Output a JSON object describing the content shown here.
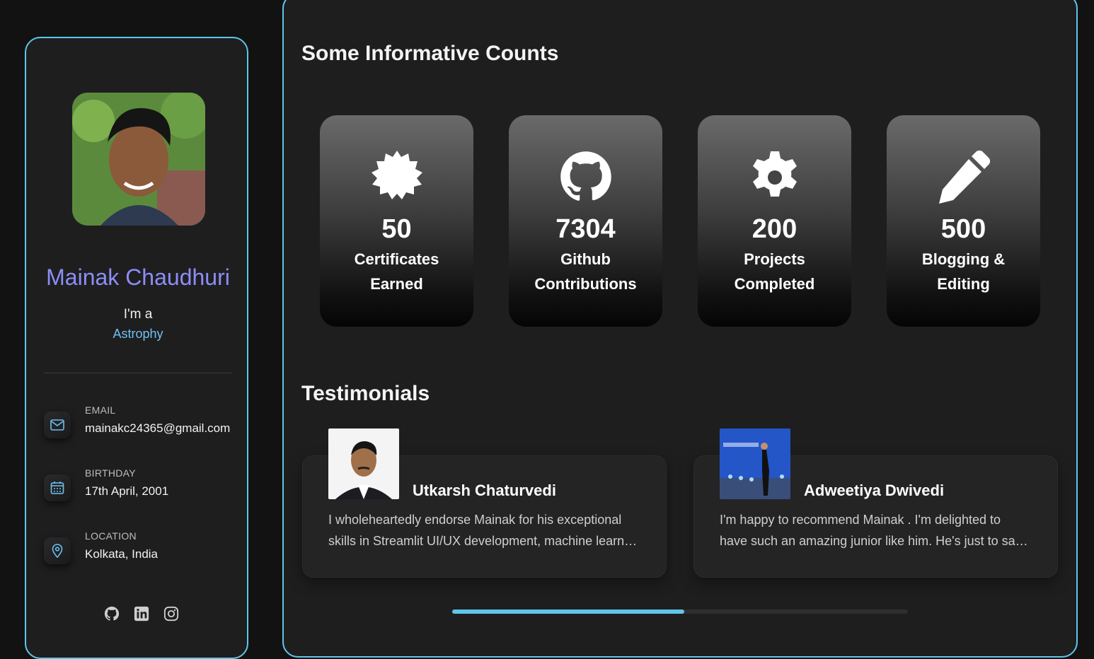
{
  "profile": {
    "name": "Mainak Chaudhuri",
    "im_a": "I'm a",
    "role": "Astrophy"
  },
  "contacts": [
    {
      "label": "EMAIL",
      "value": "mainakc24365@gmail.com",
      "icon": "mail-icon"
    },
    {
      "label": "BIRTHDAY",
      "value": "17th April, 2001",
      "icon": "calendar-icon"
    },
    {
      "label": "LOCATION",
      "value": "Kolkata, India",
      "icon": "location-pin-icon"
    }
  ],
  "socials": [
    "github-icon",
    "linkedin-icon",
    "instagram-icon"
  ],
  "counts": {
    "title": "Some Informative Counts",
    "items": [
      {
        "value": "50",
        "line1": "Certificates",
        "line2": "Earned",
        "icon": "badge-icon"
      },
      {
        "value": "7304",
        "line1": "Github",
        "line2": "Contributions",
        "icon": "github-icon"
      },
      {
        "value": "200",
        "line1": "Projects",
        "line2": "Completed",
        "icon": "gear-icon"
      },
      {
        "value": "500",
        "line1": "Blogging &",
        "line2": "Editing",
        "icon": "pencil-icon"
      }
    ]
  },
  "testimonials": {
    "title": "Testimonials",
    "items": [
      {
        "name": "Utkarsh Chaturvedi",
        "line1": "I wholeheartedly endorse Mainak for his exceptional",
        "line2": "skills in Streamlit UI/UX development, machine learnin..."
      },
      {
        "name": "Adweetiya Dwivedi",
        "line1": "I'm happy to recommend Mainak . I'm delighted to",
        "line2": "have such an amazing junior like him. He's just to say..."
      }
    ],
    "scroll_progress": 0.51
  },
  "colors": {
    "accent": "#5fc6e8",
    "name": "#8d8df7",
    "role": "#6fc0f0"
  }
}
